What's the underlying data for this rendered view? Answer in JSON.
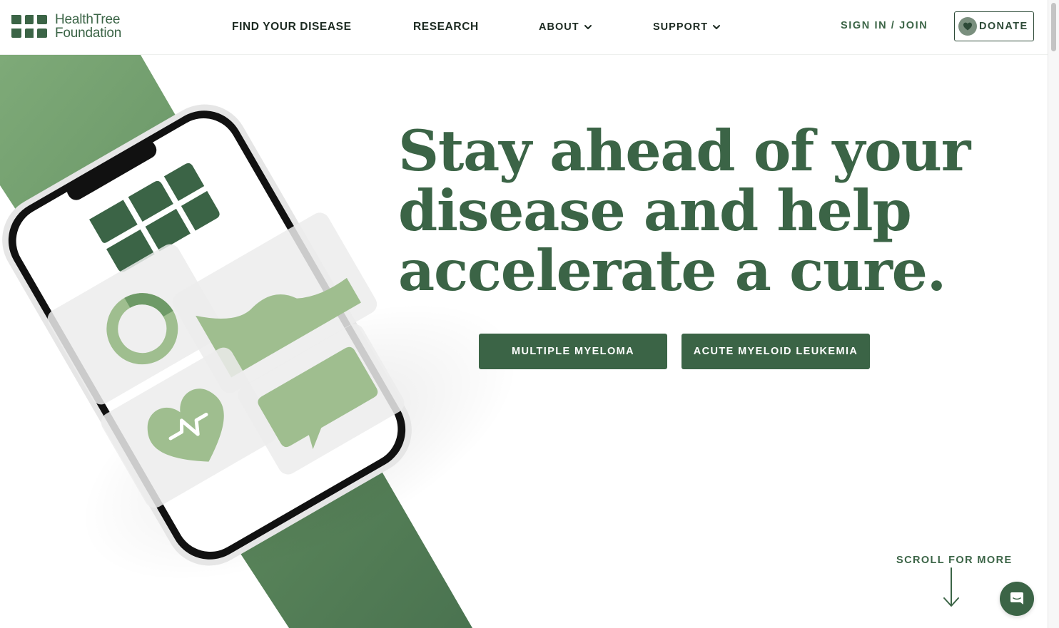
{
  "brand": {
    "name_line1": "HealthTree",
    "name_line2": "Foundation",
    "logo_icon": "leaf-grid-logo"
  },
  "nav": {
    "items": [
      {
        "label": "FIND YOUR DISEASE",
        "has_dropdown": false
      },
      {
        "label": "RESEARCH",
        "has_dropdown": false
      },
      {
        "label": "ABOUT",
        "has_dropdown": true
      },
      {
        "label": "SUPPORT",
        "has_dropdown": true
      }
    ],
    "signin_label": "SIGN IN / JOIN",
    "donate_label": "DONATE"
  },
  "hero": {
    "headline_line1": "Stay ahead of your",
    "headline_line2": "disease and help",
    "headline_line3": "accelerate a cure.",
    "buttons": [
      {
        "label": "MULTIPLE MYELOMA"
      },
      {
        "label": "ACUTE MYELOID LEUKEMIA"
      }
    ],
    "scroll_label": "SCROLL FOR MORE"
  },
  "colors": {
    "brand_green": "#3b6446",
    "light_green": "#9fbe8f",
    "underline_green": "#c7d6c2"
  },
  "icons": [
    "leaf-grid-logo",
    "chevron-down-icon",
    "heart-icon",
    "arrow-down-icon",
    "chat-icon"
  ]
}
